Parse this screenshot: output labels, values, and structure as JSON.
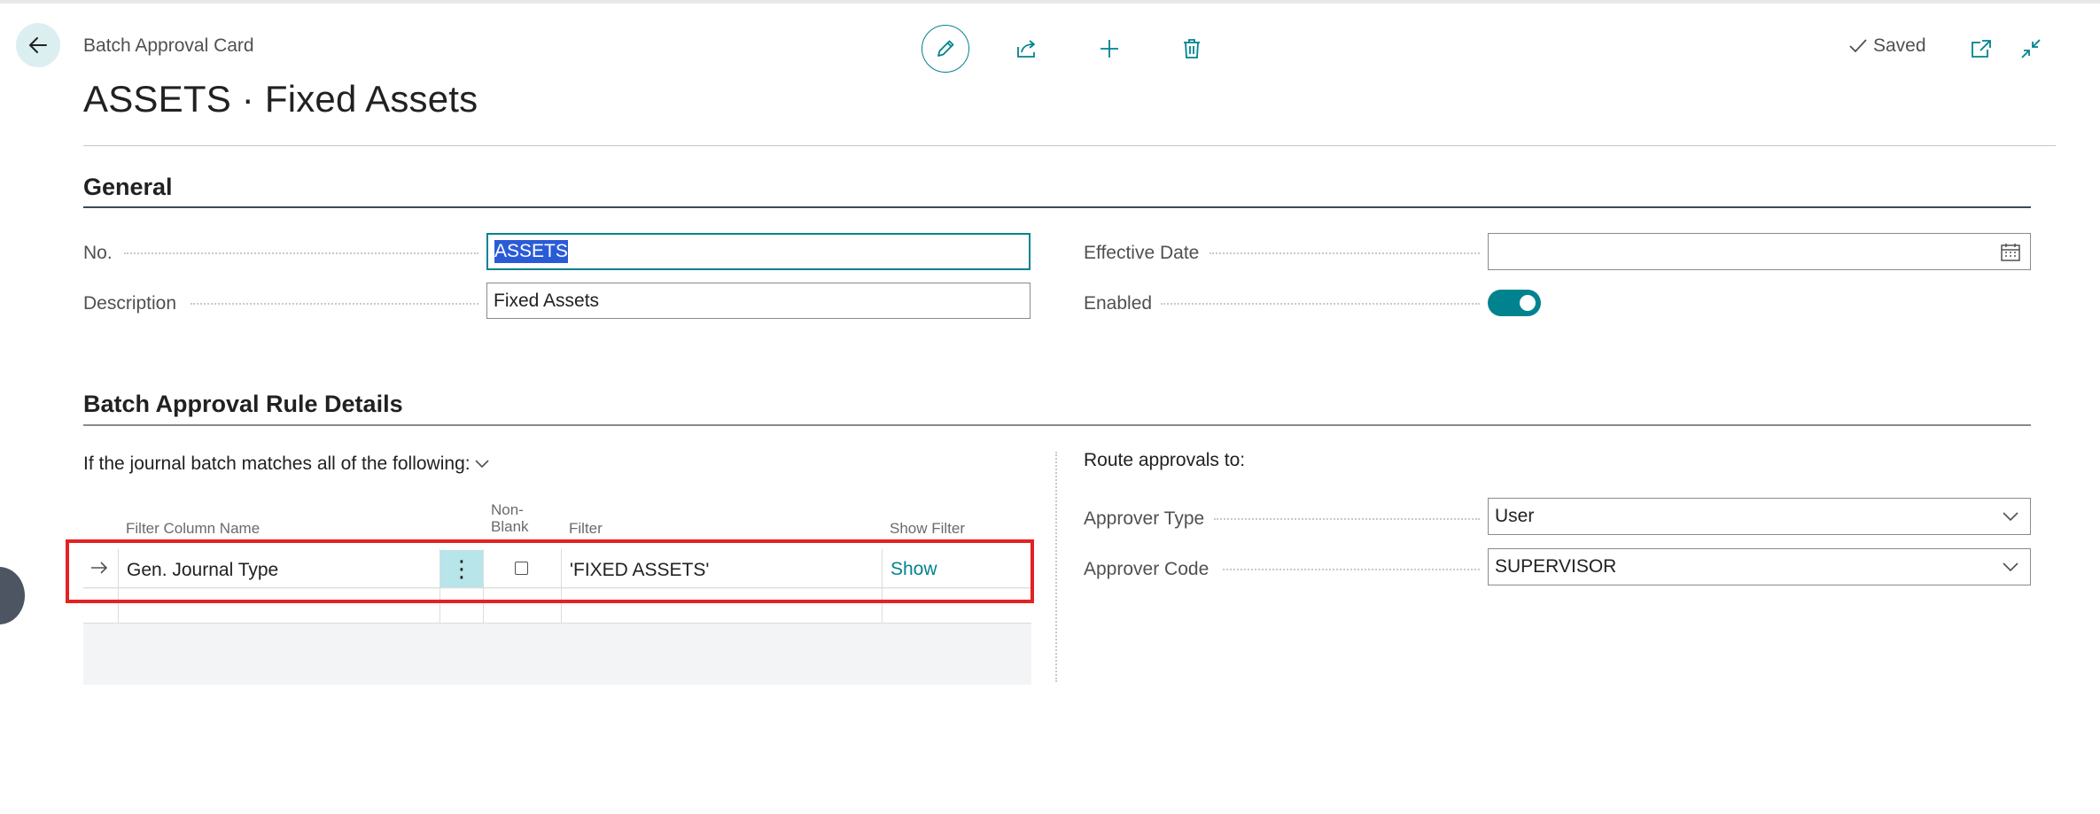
{
  "header": {
    "breadcrumb": "Batch Approval Card",
    "title": "ASSETS · Fixed Assets",
    "status": "Saved"
  },
  "general": {
    "heading": "General",
    "no_label": "No.",
    "no_value": "ASSETS",
    "description_label": "Description",
    "description_value": "Fixed Assets",
    "effective_date_label": "Effective Date",
    "effective_date_value": "",
    "enabled_label": "Enabled",
    "enabled": true
  },
  "rules": {
    "heading": "Batch Approval Rule Details",
    "match_text": "If the journal batch matches all of the following:",
    "columns": {
      "filter_column_name": "Filter Column Name",
      "non_blank_1": "Non-",
      "non_blank_2": "Blank",
      "filter": "Filter",
      "show_filter": "Show Filter"
    },
    "rows": [
      {
        "filter_column_name": "Gen. Journal Type",
        "non_blank": false,
        "filter": "'FIXED ASSETS'",
        "show_filter": "Show"
      }
    ]
  },
  "route": {
    "heading": "Route approvals to:",
    "approver_type_label": "Approver Type",
    "approver_type_value": "User",
    "approver_code_label": "Approver Code",
    "approver_code_value": "SUPERVISOR"
  },
  "colors": {
    "accent": "#00838f",
    "highlight": "#e32222",
    "selection": "#2a5bd7"
  },
  "icons": [
    "back-arrow-icon",
    "pencil-icon",
    "share-icon",
    "plus-icon",
    "trash-icon",
    "check-icon",
    "open-in-new-icon",
    "collapse-icon",
    "calendar-icon",
    "chevron-down-icon",
    "row-arrow-icon",
    "more-options-icon"
  ]
}
